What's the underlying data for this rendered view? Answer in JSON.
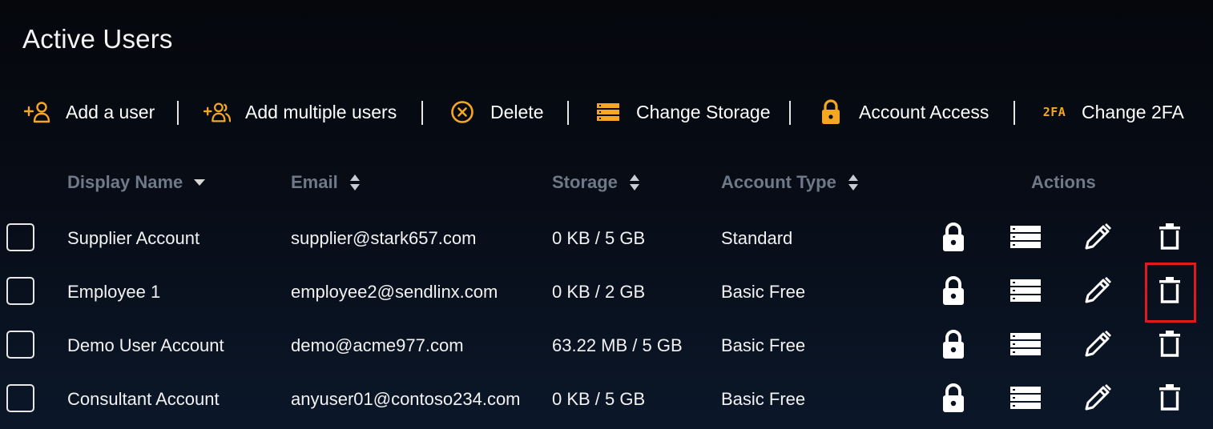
{
  "page": {
    "title": "Active Users"
  },
  "toolbar": {
    "items": [
      {
        "label": "Add a user",
        "icon": "add-user-icon"
      },
      {
        "label": "Add multiple users",
        "icon": "add-multiple-users-icon"
      },
      {
        "label": "Delete",
        "icon": "delete-circle-icon"
      },
      {
        "label": "Change Storage",
        "icon": "storage-icon"
      },
      {
        "label": "Account Access",
        "icon": "lock-icon"
      },
      {
        "label": "Change 2FA",
        "icon": "two-fa-icon",
        "icon_text": "2FA"
      }
    ],
    "accent_color": "#f5a623"
  },
  "table": {
    "columns": {
      "display_name": "Display Name",
      "email": "Email",
      "storage": "Storage",
      "account_type": "Account Type",
      "actions": "Actions"
    },
    "sort": {
      "column": "display_name",
      "direction": "descending"
    },
    "rows": [
      {
        "display_name": "Supplier Account",
        "email": "supplier@stark657.com",
        "storage": "0 KB / 5 GB",
        "account_type": "Standard"
      },
      {
        "display_name": "Employee 1",
        "email": "employee2@sendlinx.com",
        "storage": "0 KB / 2 GB",
        "account_type": "Basic Free"
      },
      {
        "display_name": "Demo User Account",
        "email": "demo@acme977.com",
        "storage": "63.22 MB / 5 GB",
        "account_type": "Basic Free"
      },
      {
        "display_name": "Consultant Account",
        "email": "anyuser01@contoso234.com",
        "storage": "0 KB / 5 GB",
        "account_type": "Basic Free"
      }
    ],
    "row_actions": [
      "lock-icon",
      "storage-icon",
      "edit-pencil-icon",
      "trash-icon"
    ]
  },
  "highlight": {
    "target": "row 2 delete action",
    "color": "#e0191e"
  }
}
